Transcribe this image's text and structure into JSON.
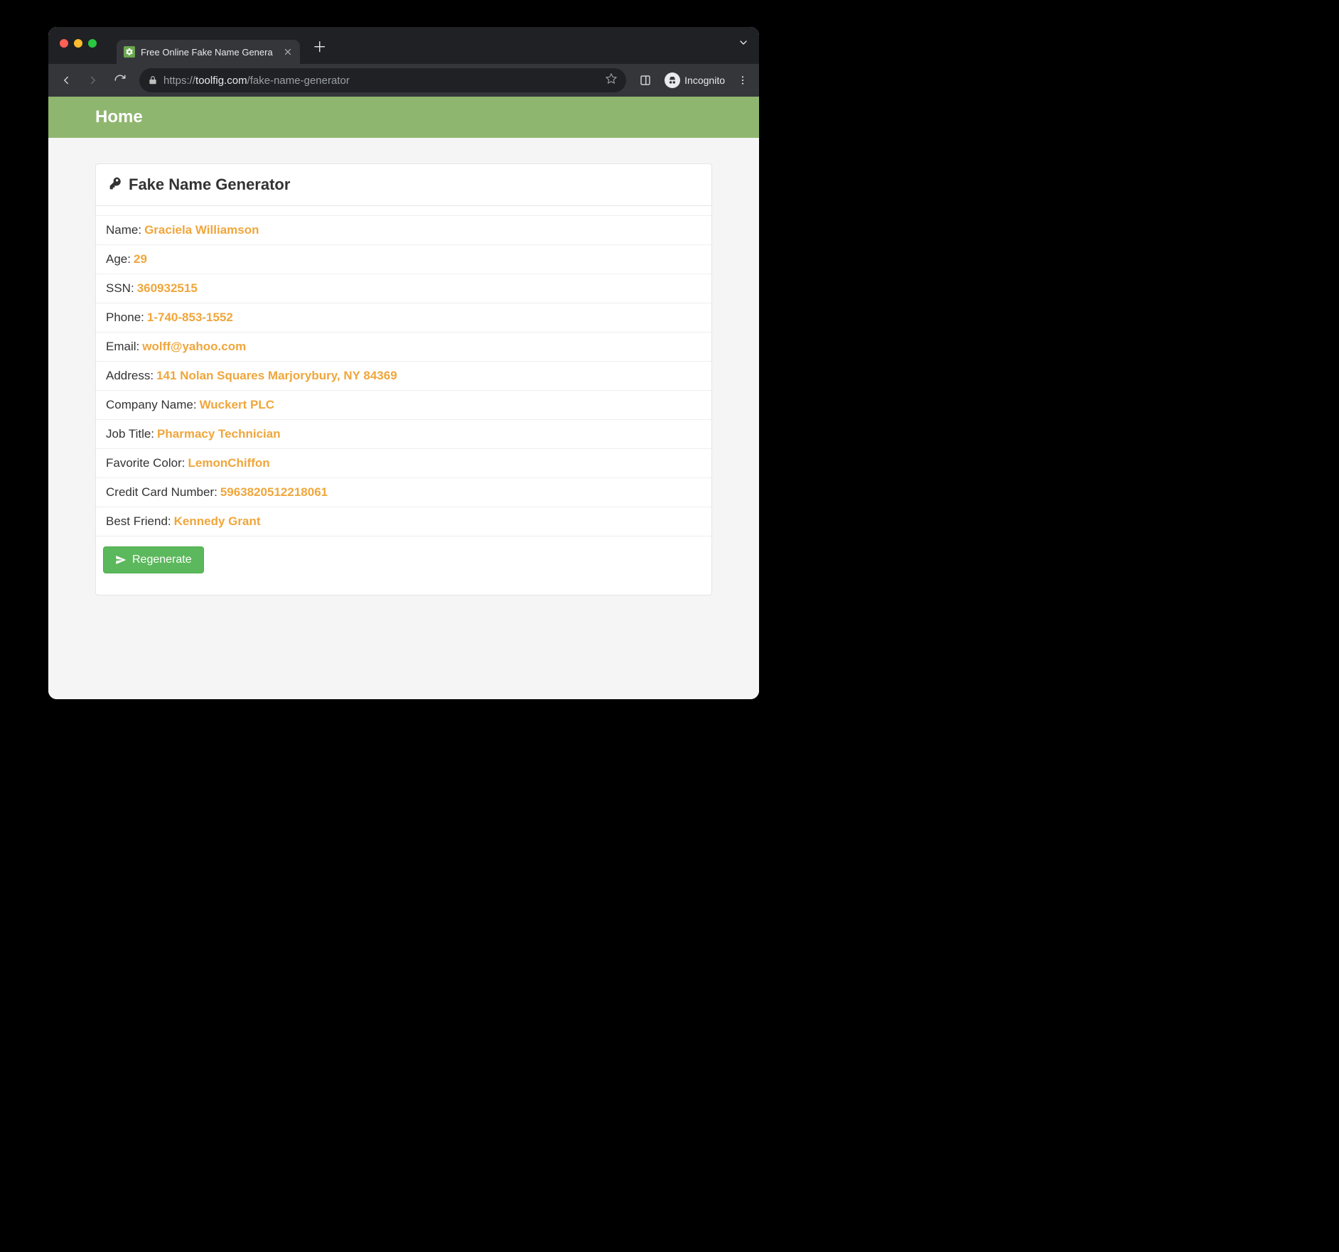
{
  "browser": {
    "tab_title": "Free Online Fake Name Genera",
    "url_proto": "https://",
    "url_host": "toolfig.com",
    "url_path": "/fake-name-generator",
    "incognito_label": "Incognito"
  },
  "topbar": {
    "home_label": "Home"
  },
  "panel": {
    "title": "Fake Name Generator"
  },
  "fields": [
    {
      "label": "Name:",
      "value": "Graciela Williamson"
    },
    {
      "label": "Age:",
      "value": "29"
    },
    {
      "label": "SSN:",
      "value": "360932515"
    },
    {
      "label": "Phone:",
      "value": "1-740-853-1552"
    },
    {
      "label": "Email:",
      "value": "wolff@yahoo.com"
    },
    {
      "label": "Address:",
      "value": "141 Nolan Squares Marjorybury, NY 84369"
    },
    {
      "label": "Company Name:",
      "value": "Wuckert PLC"
    },
    {
      "label": "Job Title:",
      "value": "Pharmacy Technician"
    },
    {
      "label": "Favorite Color:",
      "value": "LemonChiffon"
    },
    {
      "label": "Credit Card Number:",
      "value": "5963820512218061"
    },
    {
      "label": "Best Friend:",
      "value": "Kennedy Grant"
    }
  ],
  "actions": {
    "regenerate_label": "Regenerate"
  }
}
